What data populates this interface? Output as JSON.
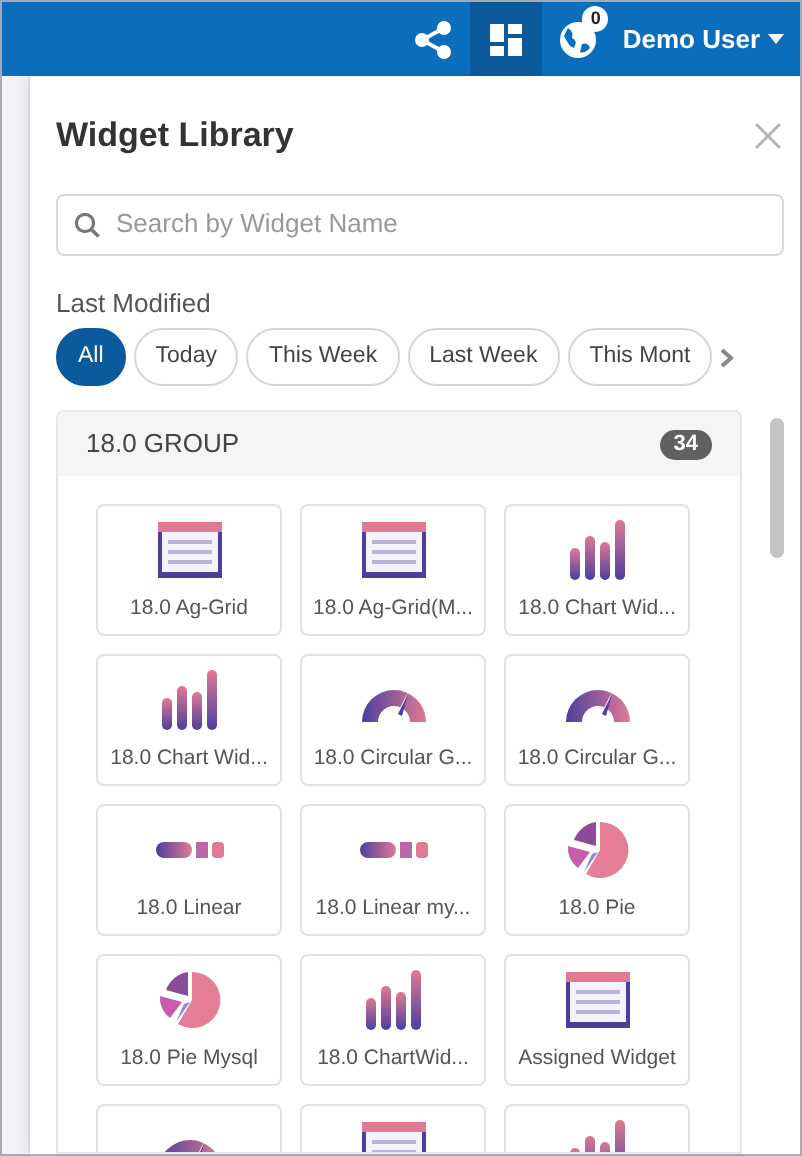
{
  "toolbar": [
    {
      "kind": "share",
      "selected": false
    },
    {
      "kind": "dashboard",
      "selected": true
    },
    {
      "kind": "globe",
      "selected": false,
      "badge": "0"
    }
  ],
  "user": {
    "name": "Demo User"
  },
  "panel": {
    "title": "Widget Library",
    "search": {
      "placeholder": "Search by Widget Name"
    },
    "filter_label": "Last Modified",
    "filters": [
      {
        "label": "All",
        "selected": true
      },
      {
        "label": "Today",
        "selected": false
      },
      {
        "label": "This Week",
        "selected": false
      },
      {
        "label": "Last Week",
        "selected": false
      },
      {
        "label": "This Mont",
        "selected": false
      }
    ],
    "group": {
      "name": "18.0 GROUP",
      "count": "34",
      "widgets": [
        {
          "kind": "grid",
          "name": "18.0 Ag-Grid"
        },
        {
          "kind": "grid",
          "name": "18.0 Ag-Grid(M..."
        },
        {
          "kind": "bars",
          "name": "18.0 Chart Wid..."
        },
        {
          "kind": "bars",
          "name": "18.0 Chart Wid..."
        },
        {
          "kind": "gauge",
          "name": "18.0 Circular G..."
        },
        {
          "kind": "gauge",
          "name": "18.0 Circular G..."
        },
        {
          "kind": "linear",
          "name": "18.0 Linear"
        },
        {
          "kind": "linear",
          "name": "18.0 Linear my..."
        },
        {
          "kind": "pie",
          "name": "18.0 Pie"
        },
        {
          "kind": "pie",
          "name": "18.0 Pie Mysql"
        },
        {
          "kind": "bars",
          "name": "18.0 ChartWid..."
        },
        {
          "kind": "grid",
          "name": "Assigned Widget"
        },
        {
          "kind": "gauge"
        },
        {
          "kind": "grid"
        },
        {
          "kind": "bars"
        }
      ]
    }
  }
}
